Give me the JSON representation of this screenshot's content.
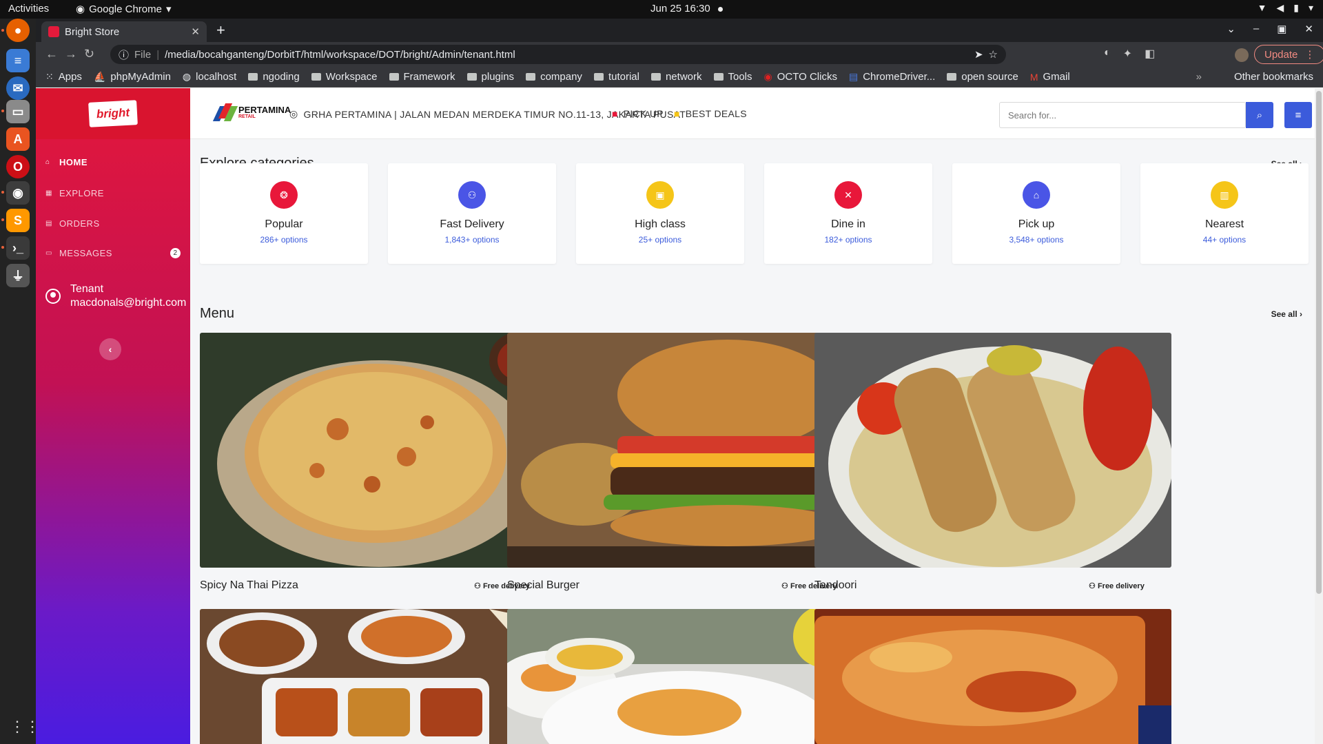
{
  "os": {
    "activities": "Activities",
    "app_name": "Google Chrome",
    "clock": "Jun 25  16:30"
  },
  "browser": {
    "tab_title": "Bright Store",
    "url_scheme": "File",
    "url": "/media/bocahganteng/DorbitT/html/workspace/DOT/bright/Admin/tenant.html",
    "update_label": "Update",
    "bookmarks": [
      "Apps",
      "phpMyAdmin",
      "localhost",
      "ngoding",
      "Workspace",
      "Framework",
      "plugins",
      "company",
      "tutorial",
      "network",
      "Tools",
      "OCTO Clicks",
      "ChromeDriver...",
      "open source",
      "Gmail"
    ],
    "other_bookmarks": "Other bookmarks"
  },
  "sidebar": {
    "logo_text": "bright",
    "items": [
      {
        "label": "HOME",
        "icon": "home-icon"
      },
      {
        "label": "EXPLORE",
        "icon": "grid-icon"
      },
      {
        "label": "ORDERS",
        "icon": "list-icon"
      },
      {
        "label": "MESSAGES",
        "icon": "chat-icon",
        "badge": "2"
      }
    ],
    "user_role": "Tenant",
    "user_email": "macdonals@bright.com"
  },
  "header": {
    "brand_name": "PERTAMINA",
    "brand_sub": "RETAIL",
    "address": "GRHA PERTAMINA | JALAN MEDAN MERDEKA TIMUR NO.11-13, JAKARTA PUSAT",
    "pickup_label": "PICK UP",
    "deals_label": "BEST DEALS",
    "search_placeholder": "Search for..."
  },
  "categories": {
    "title": "Explore categories",
    "see_all": "See all",
    "items": [
      {
        "name": "Popular",
        "options": "286+ options",
        "color": "#e8173a",
        "icon": "flame-icon"
      },
      {
        "name": "Fast Delivery",
        "options": "1,843+ options",
        "color": "#4a55e6",
        "icon": "bike-icon"
      },
      {
        "name": "High class",
        "options": "25+ options",
        "color": "#f5c518",
        "icon": "wallet-icon"
      },
      {
        "name": "Dine in",
        "options": "182+ options",
        "color": "#e8173a",
        "icon": "cutlery-icon"
      },
      {
        "name": "Pick up",
        "options": "3,548+ options",
        "color": "#4a55e6",
        "icon": "store-icon"
      },
      {
        "name": "Nearest",
        "options": "44+ options",
        "color": "#f5c518",
        "icon": "map-icon"
      }
    ]
  },
  "menu": {
    "title": "Menu",
    "see_all": "See all",
    "items": [
      {
        "name": "Spicy Na Thai Pizza",
        "delivery": "Free delivery"
      },
      {
        "name": "Special Burger",
        "delivery": "Free delivery"
      },
      {
        "name": "Tandoori",
        "delivery": "Free delivery"
      }
    ]
  },
  "colors": {
    "primary_red": "#e8173a",
    "primary_blue": "#3b5bdb"
  }
}
